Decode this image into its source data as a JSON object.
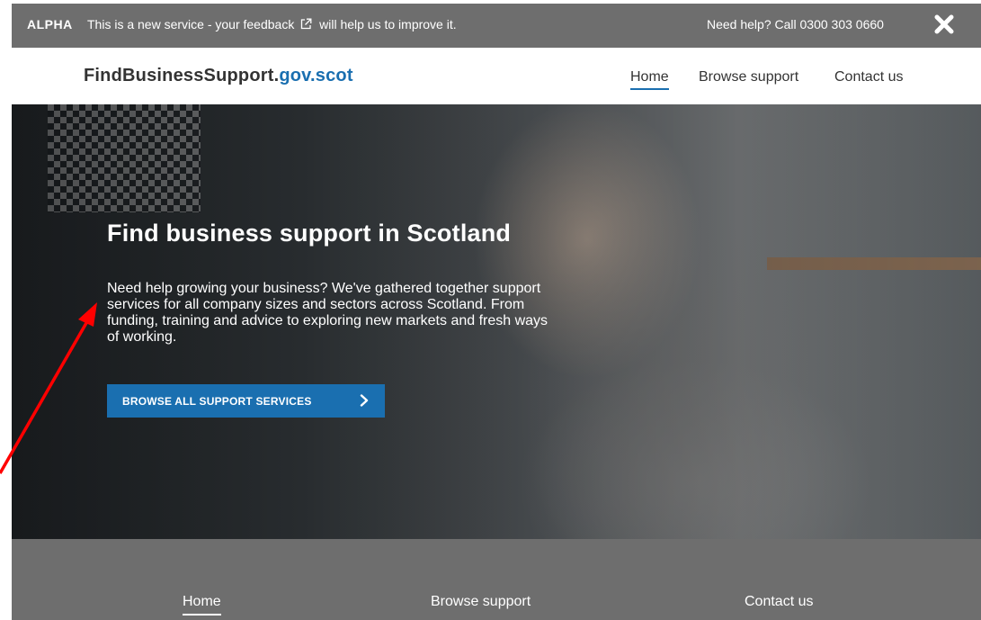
{
  "banner": {
    "tag": "ALPHA",
    "message_prefix": "This is a new service - your feedback",
    "message_suffix": "will help us to improve it.",
    "help": "Need help? Call 0300 303 0660"
  },
  "header": {
    "logo_main": "FindBusinessSupport.",
    "logo_accent": "gov.scot",
    "nav": [
      "Home",
      "Browse support",
      "Contact us"
    ]
  },
  "hero": {
    "title": "Find business support in Scotland",
    "description": "Need help growing your business? We've gathered together support services for all company sizes and sectors across Scotland. From funding, training and advice to exploring new markets and fresh ways of working.",
    "cta": "BROWSE ALL SUPPORT SERVICES"
  },
  "footer": {
    "nav": [
      "Home",
      "Browse support",
      "Contact us"
    ]
  },
  "colors": {
    "accent": "#1a6fb0",
    "banner_bg": "#6e6e6e",
    "annotation": "#ff0000"
  },
  "icons": {
    "external_link": "external-link-icon",
    "close": "close-icon",
    "chevron": "chevron-right-icon"
  }
}
